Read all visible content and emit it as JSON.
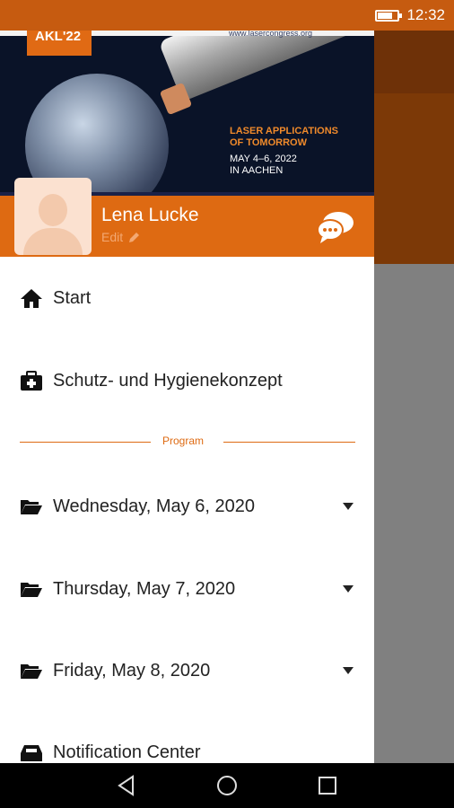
{
  "status_bar": {
    "time": "12:32",
    "battery_level": 0.75
  },
  "banner": {
    "logo_text": "AKL'22",
    "url": "www.lasercongress.org",
    "headline_line1": "LASER APPLICATIONS",
    "headline_line2": "OF TOMORROW",
    "date_line1": "MAY 4–6, 2022",
    "date_line2": "IN AACHEN"
  },
  "profile": {
    "name": "Lena Lucke",
    "edit_label": "Edit"
  },
  "menu": {
    "items": [
      {
        "label": "Start",
        "icon": "home-icon"
      },
      {
        "label": "Schutz- und Hygienekonzept",
        "icon": "medical-kit-icon"
      }
    ],
    "section_label": "Program",
    "program_items": [
      {
        "label": "Wednesday, May 6, 2020",
        "icon": "folder-open-icon"
      },
      {
        "label": "Thursday, May 7, 2020",
        "icon": "folder-open-icon"
      },
      {
        "label": "Friday, May 8, 2020",
        "icon": "folder-open-icon"
      }
    ],
    "notification_label": "Notification Center"
  },
  "colors": {
    "accent": "#de6a12",
    "status_bar": "#c65b10",
    "navy": "#1b2248"
  }
}
